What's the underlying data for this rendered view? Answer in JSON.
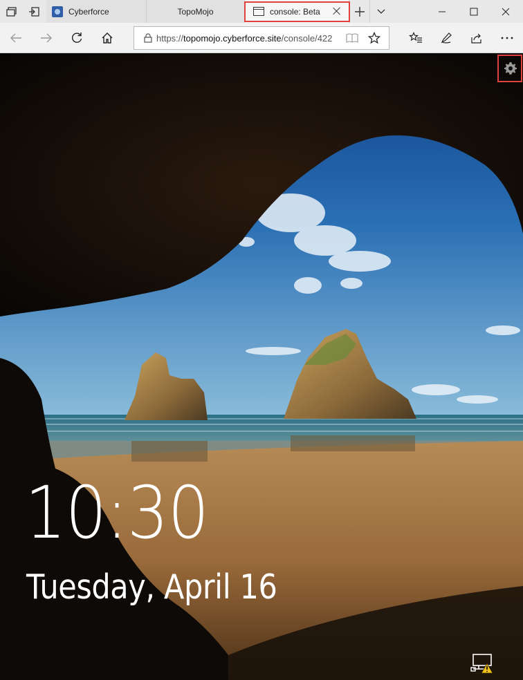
{
  "browser": {
    "tabs": [
      {
        "label": "Cyberforce"
      },
      {
        "label": "TopoMojo"
      },
      {
        "label": "console: Beta"
      }
    ],
    "address": {
      "scheme": "https://",
      "host": "topomojo.cyberforce.site",
      "path": "/console/422"
    },
    "colors": {
      "highlight": "#e0413a",
      "tabstrip": "#e8e8e8"
    }
  },
  "lockscreen": {
    "time": "10:30",
    "date": "Tuesday, April 16"
  },
  "icons": {
    "settings": "gear-icon",
    "network_status": "network-warning-icon"
  }
}
